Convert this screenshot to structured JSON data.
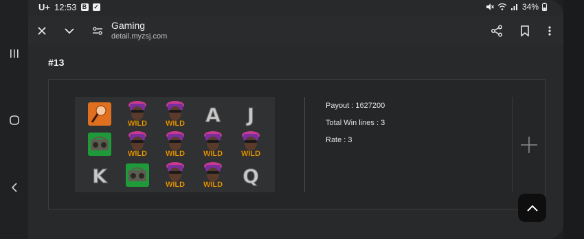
{
  "status_bar": {
    "carrier": "U+",
    "time": "12:53",
    "battery": "34%"
  },
  "toolbar": {
    "title": "Gaming",
    "url": "detail.myzsj.com"
  },
  "item": {
    "number": "#13",
    "payout": "Payout : 1627200",
    "total_win_lines": "Total Win lines : 3",
    "rate": "Rate : 3"
  },
  "reel": {
    "rows": [
      [
        "mic",
        "wild",
        "wild",
        "A",
        "J"
      ],
      [
        "boombox",
        "wild",
        "wild",
        "wild",
        "wild"
      ],
      [
        "K",
        "boombox",
        "wild",
        "wild",
        "Q"
      ]
    ],
    "wild_label": "WILD"
  },
  "colors": {
    "background": "#28292b",
    "accent_orange": "#e07020",
    "accent_green": "#1f9a3a",
    "wild_gold": "#f4c21a"
  }
}
